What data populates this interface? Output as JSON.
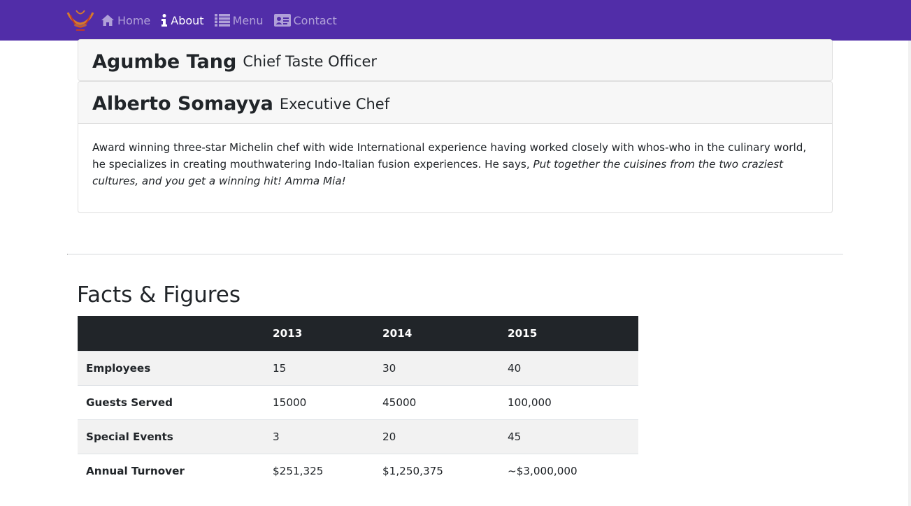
{
  "nav": {
    "brand_logo": "restaurant-logo",
    "items": [
      {
        "label": "Home",
        "icon": "home-icon",
        "active": false
      },
      {
        "label": "About",
        "icon": "info-icon",
        "active": true
      },
      {
        "label": "Menu",
        "icon": "list-icon",
        "active": false
      },
      {
        "label": "Contact",
        "icon": "address-card-icon",
        "active": false
      }
    ]
  },
  "leadership": [
    {
      "name": "Agumbe Tang",
      "role": "Chief Taste Officer",
      "expanded": false
    },
    {
      "name": "Alberto Somayya",
      "role": "Executive Chef",
      "expanded": true,
      "bio": "Award winning three-star Michelin chef with wide International experience having worked closely with whos-who in the culinary world, he specializes in creating mouthwatering Indo-Italian fusion experiences. He says, ",
      "quote": "Put together the cuisines from the two craziest cultures, and you get a winning hit! Amma Mia!"
    }
  ],
  "facts": {
    "title": "Facts & Figures",
    "headers": [
      "",
      "2013",
      "2014",
      "2015"
    ],
    "rows": [
      {
        "label": "Employees",
        "values": [
          "15",
          "30",
          "40"
        ]
      },
      {
        "label": "Guests Served",
        "values": [
          "15000",
          "45000",
          "100,000"
        ]
      },
      {
        "label": "Special Events",
        "values": [
          "3",
          "20",
          "45"
        ]
      },
      {
        "label": "Annual Turnover",
        "values": [
          "$251,325",
          "$1,250,375",
          "~$3,000,000"
        ]
      }
    ]
  },
  "colors": {
    "navbar": "#512DA8",
    "table_header": "#212529",
    "logo": "#D67A2C"
  }
}
